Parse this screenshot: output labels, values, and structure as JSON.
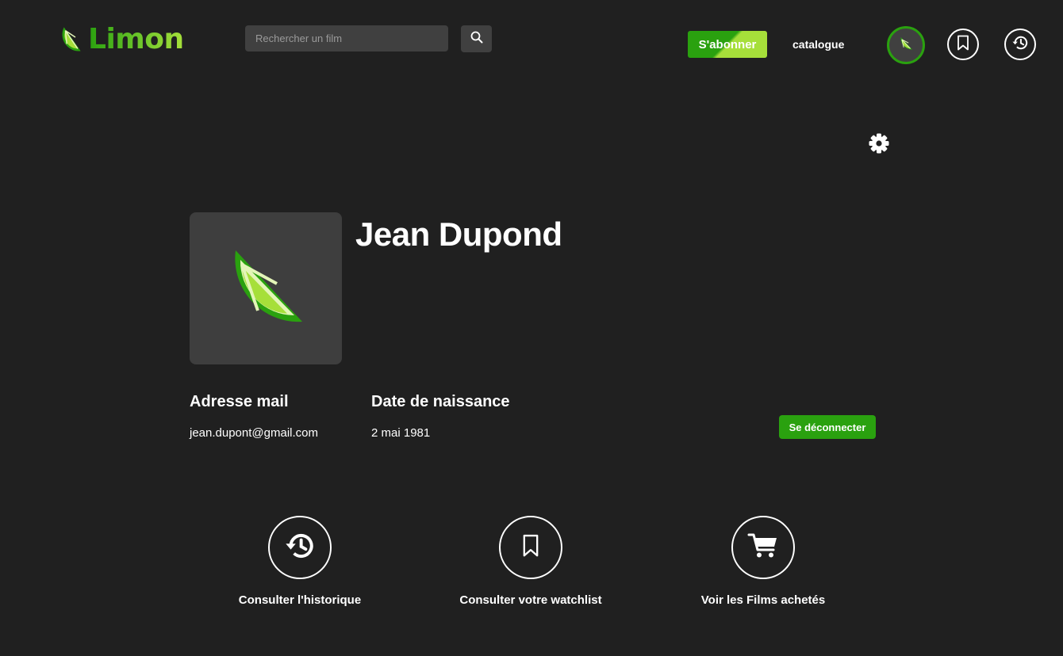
{
  "header": {
    "brand": "Limon",
    "search": {
      "placeholder": "Rechercher un film",
      "value": ""
    },
    "subscribe_label": "S'abonner",
    "catalogue_label": "catalogue",
    "icons": [
      "lime-icon",
      "search-icon",
      "bookmark-icon",
      "history-icon",
      "gear-icon"
    ]
  },
  "profile": {
    "name": "Jean Dupond",
    "email_label": "Adresse mail",
    "email": "jean.dupont@gmail.com",
    "birthdate_label": "Date de naissance",
    "birthdate": "2 mai 1981",
    "logout_label": "Se déconnecter"
  },
  "actions": [
    {
      "label": "Consulter l'historique",
      "icon": "history-icon"
    },
    {
      "label": "Consulter votre watchlist",
      "icon": "bookmark-icon"
    },
    {
      "label": "Voir les Films achetés",
      "icon": "cart-icon"
    }
  ],
  "colors": {
    "background": "#202020",
    "panel": "#404040",
    "accent_green": "#2aa10f",
    "accent_lime": "#a6df3a",
    "text": "#ffffff"
  }
}
